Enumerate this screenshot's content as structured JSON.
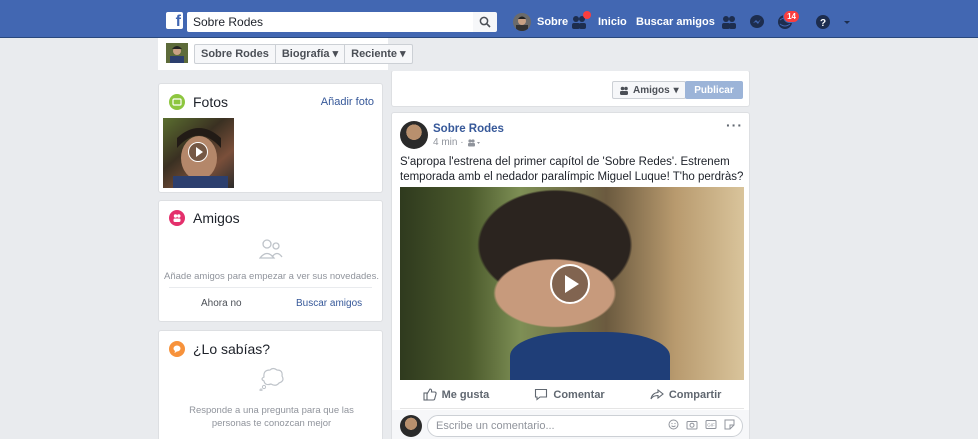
{
  "topbar": {
    "search_value": "Sobre Rodes",
    "profile_name": "Sobre",
    "nav_home": "Inicio",
    "nav_find_friends": "Buscar amigos",
    "notifications_count": "14"
  },
  "profile_header": {
    "buttons": [
      "Sobre Rodes",
      "Biografía",
      "Reciente"
    ]
  },
  "photos_card": {
    "title": "Fotos",
    "add_link": "Añadir foto"
  },
  "friends_card": {
    "title": "Amigos",
    "description": "Añade amigos para empezar a ver sus novedades.",
    "not_now": "Ahora no",
    "find_friends": "Buscar amigos"
  },
  "did_you_know_card": {
    "title": "¿Lo sabías?",
    "description": "Responde a una pregunta para que las personas te conozcan mejor"
  },
  "composer": {
    "audience": "Amigos",
    "publish": "Publicar"
  },
  "post": {
    "author": "Sobre Rodes",
    "time": "4 min ·",
    "text": "S'apropa l'estrena del primer capítol de 'Sobre Redes'. Estrenem temporada amb el nedador paralímpic Miguel Luque! T'ho perdràs?",
    "actions": {
      "like": "Me gusta",
      "comment": "Comentar",
      "share": "Compartir"
    },
    "comment_placeholder": "Escribe un comentario..."
  },
  "colors": {
    "brand_blue": "#4267b2",
    "link": "#365899",
    "photos_icon": "#8dc63f",
    "friends_icon": "#e4306c",
    "did_you_know_icon": "#f7923b"
  }
}
